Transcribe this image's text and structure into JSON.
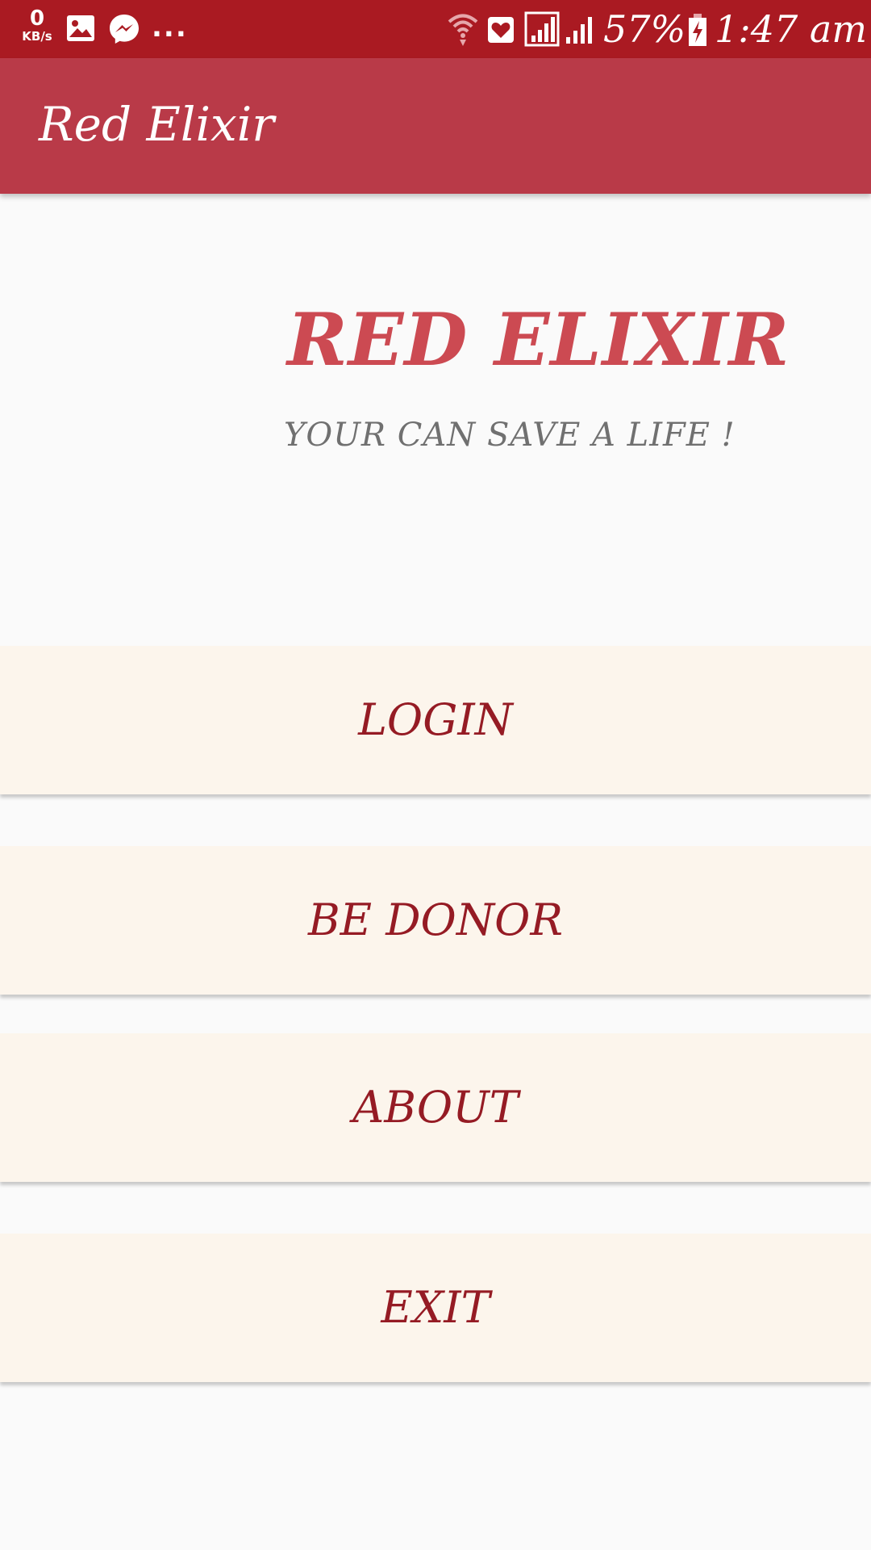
{
  "status_bar": {
    "network_speed_value": "0",
    "network_speed_unit": "KB/s",
    "overflow_indicator": "...",
    "battery_percent": "57%",
    "time": "1:47 am",
    "icons": [
      "gallery-icon",
      "messenger-icon",
      "wifi-icon",
      "heart-notification-icon",
      "signal-icon",
      "signal-icon-2",
      "battery-charging-icon"
    ],
    "background_color": "#aa1a22"
  },
  "app_bar": {
    "title": "Red Elixir",
    "background_color": "#b93a48"
  },
  "hero": {
    "title": "RED ELIXIR",
    "subtitle": "YOUR  CAN SAVE A LIFE !",
    "title_color": "#cc4a52",
    "subtitle_color": "#707070"
  },
  "menu": {
    "login_label": "LOGIN",
    "donor_label": "BE DONOR",
    "about_label": "ABOUT",
    "exit_label": "EXIT",
    "button_background": "#fcf5ec",
    "label_color": "#951b24"
  }
}
